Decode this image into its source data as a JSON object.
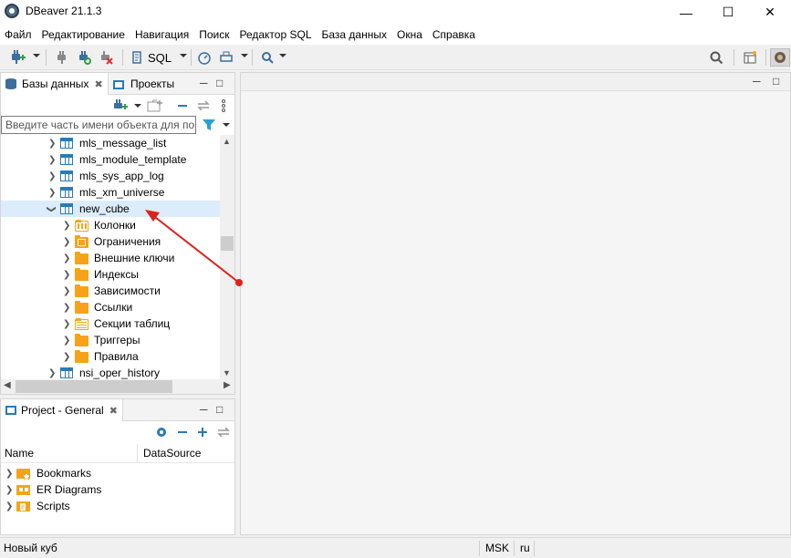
{
  "window": {
    "title": "DBeaver 21.1.3"
  },
  "menu": [
    "Файл",
    "Редактирование",
    "Навигация",
    "Поиск",
    "Редактор SQL",
    "База данных",
    "Окна",
    "Справка"
  ],
  "toolbar": {
    "sql_label": "SQL"
  },
  "navigator": {
    "tab_databases": "Базы данных",
    "tab_projects": "Проекты",
    "search_placeholder": "Введите часть имени объекта для пои",
    "tree": [
      {
        "label": "mls_message_list",
        "type": "table",
        "expanded": false,
        "level": 0
      },
      {
        "label": "mls_module_template",
        "type": "table",
        "expanded": false,
        "level": 0
      },
      {
        "label": "mls_sys_app_log",
        "type": "table",
        "expanded": false,
        "level": 0
      },
      {
        "label": "mls_xm_universe",
        "type": "table",
        "expanded": false,
        "level": 0
      },
      {
        "label": "new_cube",
        "type": "table",
        "expanded": true,
        "level": 0,
        "selected": true
      },
      {
        "label": "Колонки",
        "type": "columns",
        "level": 1
      },
      {
        "label": "Ограничения",
        "type": "constraints",
        "level": 1
      },
      {
        "label": "Внешние ключи",
        "type": "folder",
        "level": 1
      },
      {
        "label": "Индексы",
        "type": "folder",
        "level": 1
      },
      {
        "label": "Зависимости",
        "type": "folder",
        "level": 1
      },
      {
        "label": "Ссылки",
        "type": "folder",
        "level": 1
      },
      {
        "label": "Секции таблиц",
        "type": "partitions",
        "level": 1
      },
      {
        "label": "Триггеры",
        "type": "folder",
        "level": 1
      },
      {
        "label": "Правила",
        "type": "folder",
        "level": 1
      },
      {
        "label": "nsi_oper_history",
        "type": "table",
        "expanded": false,
        "level": 0
      }
    ]
  },
  "project": {
    "title": "Project - General",
    "col_name": "Name",
    "col_datasource": "DataSource",
    "items": [
      "Bookmarks",
      "ER Diagrams",
      "Scripts"
    ]
  },
  "status": {
    "left": "Новый куб",
    "tz": "MSK",
    "lang": "ru"
  },
  "colors": {
    "accent": "#2a7ab8",
    "folder": "#f6a31a",
    "annotation_arrow": "#e0201b",
    "selection": "#dcecfc"
  }
}
